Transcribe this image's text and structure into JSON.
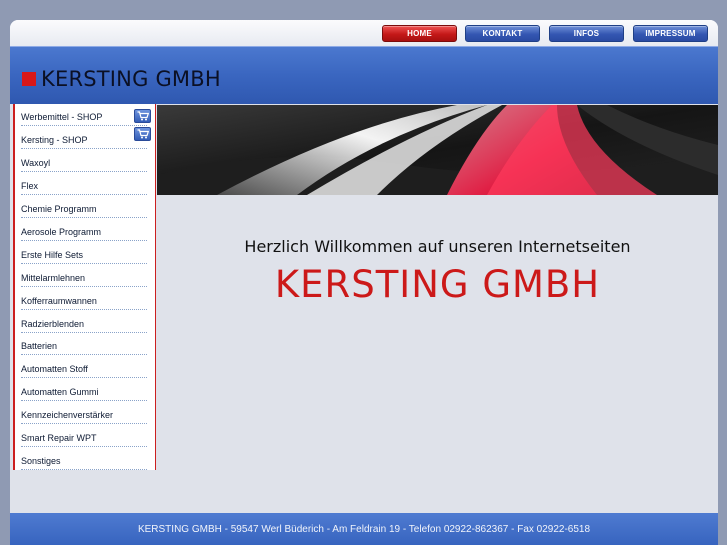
{
  "nav": {
    "home": "HOME",
    "kontakt": "KONTAKT",
    "infos": "INFOS",
    "impressum": "IMPRESSUM"
  },
  "header": {
    "logo_text": "KERSTING GMBH"
  },
  "sidebar": {
    "items": [
      {
        "label": "Werbemittel - SHOP",
        "icon": "shopping-cart-icon"
      },
      {
        "label": "Kersting - SHOP",
        "icon": "shopping-cart-icon"
      },
      {
        "label": "Waxoyl"
      },
      {
        "label": "Flex"
      },
      {
        "label": "Chemie Programm"
      },
      {
        "label": "Aerosole Programm"
      },
      {
        "label": "Erste Hilfe Sets"
      },
      {
        "label": "Mittelarmlehnen"
      },
      {
        "label": "Kofferraumwannen"
      },
      {
        "label": "Radzierblenden"
      },
      {
        "label": "Batterien"
      },
      {
        "label": "Automatten Stoff"
      },
      {
        "label": "Automatten Gummi"
      },
      {
        "label": "Kennzeichenverstärker"
      },
      {
        "label": "Smart Repair WPT"
      },
      {
        "label": "Sonstiges"
      }
    ]
  },
  "main": {
    "welcome": "Herzlich Willkommen auf unseren Internetseiten",
    "brand": "KERSTING GMBH"
  },
  "footer": {
    "text": "KERSTING GMBH - 59547 Werl Büderich - Am Feldrain 19 - Telefon 02922-862367 - Fax 02922-6518"
  },
  "colors": {
    "accent_red": "#cc1919",
    "nav_blue": "#3457b2",
    "header_blue": "#3a66c0"
  }
}
